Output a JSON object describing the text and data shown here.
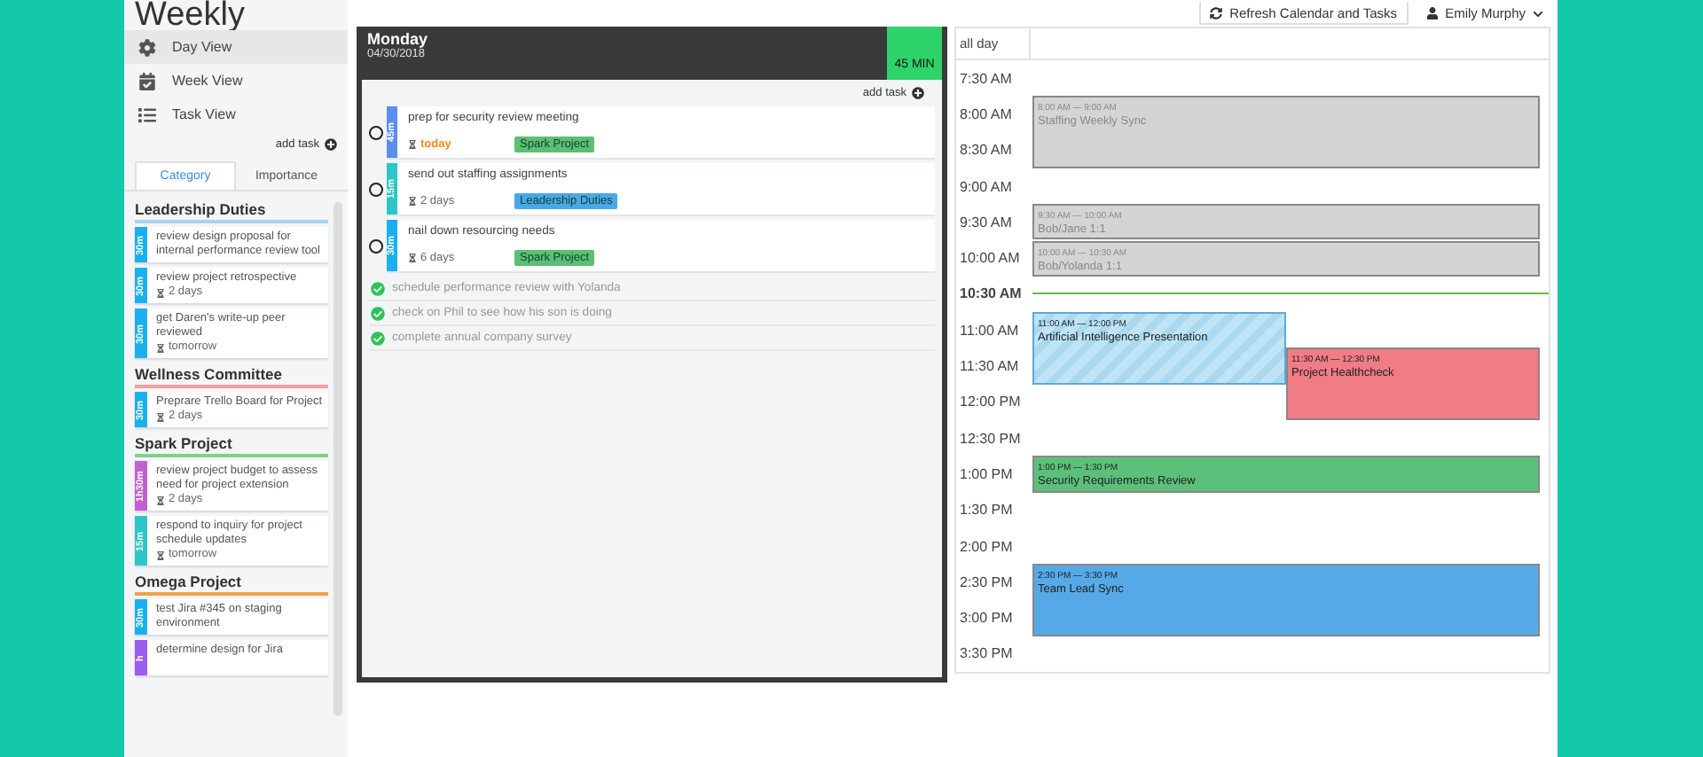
{
  "sidebar": {
    "title": "Weekly",
    "nav": [
      {
        "label": "Day View",
        "selected": true
      },
      {
        "label": "Week View",
        "selected": false
      },
      {
        "label": "Task View",
        "selected": false
      }
    ],
    "add_task": "add task",
    "tabs": [
      {
        "label": "Category",
        "selected": true
      },
      {
        "label": "Importance",
        "selected": false
      }
    ],
    "groups": [
      {
        "name": "Leadership Duties",
        "color": "#a9d3f0",
        "tasks": [
          {
            "duration": "30m",
            "color": "#1ab0f0",
            "title": "review design proposal for internal performance review tool"
          },
          {
            "duration": "30m",
            "color": "#1ab0f0",
            "title": "review project retrospective",
            "due": "2 days"
          },
          {
            "duration": "30m",
            "color": "#1ab0f0",
            "title": "get Daren's write-up peer reviewed",
            "due": "tomorrow"
          }
        ]
      },
      {
        "name": "Wellness Committee",
        "color": "#f2a0a0",
        "tasks": [
          {
            "duration": "30m",
            "color": "#1ab0f0",
            "title": "Preprare Trello Board for Project",
            "due": "2 days"
          }
        ]
      },
      {
        "name": "Spark Project",
        "color": "#7fd08a",
        "tasks": [
          {
            "duration": "1h30m",
            "color": "#c45fd4",
            "title": "review project budget to assess need for project extension",
            "due": "2 days"
          },
          {
            "duration": "15m",
            "color": "#2cc6c6",
            "title": "respond to inquiry for project schedule updates",
            "due": "tomorrow"
          }
        ]
      },
      {
        "name": "Omega Project",
        "color": "#f5a04a",
        "tasks": [
          {
            "duration": "30m",
            "color": "#1ab0f0",
            "title": "test Jira #345 on staging environment"
          },
          {
            "duration": "h",
            "color": "#9b5cf0",
            "title": "determine design for Jira"
          }
        ]
      }
    ]
  },
  "toolbar": {
    "refresh": "Refresh Calendar and Tasks",
    "user": "Emily Murphy"
  },
  "day": {
    "name": "Monday",
    "date": "04/30/2018",
    "total": "45 MIN",
    "add_task": "add task",
    "tasks": [
      {
        "done": false,
        "duration": "45m",
        "color": "#5b8def",
        "title": "prep for security review meeting",
        "due": "today",
        "due_today": true,
        "tag": {
          "label": "Spark Project",
          "color": "#5cbf73"
        }
      },
      {
        "done": false,
        "duration": "15m",
        "color": "#2cc6c6",
        "title": "send out staffing assignments",
        "due": "2 days",
        "due_today": false,
        "tag": {
          "label": "Leadership Duties",
          "color": "#4aa8e8"
        }
      },
      {
        "done": false,
        "duration": "30m",
        "color": "#1ab0f0",
        "title": "nail down resourcing needs",
        "due": "6 days",
        "due_today": false,
        "tag": {
          "label": "Spark Project",
          "color": "#5cbf73"
        }
      },
      {
        "done": true,
        "title": "schedule performance review with Yolanda"
      },
      {
        "done": true,
        "title": "check on Phil to see how his son is doing"
      },
      {
        "done": true,
        "title": "complete annual company survey"
      }
    ]
  },
  "calendar": {
    "all_day": "all day",
    "slots": [
      {
        "label": "7:30 AM",
        "current": false
      },
      {
        "label": "8:00 AM",
        "current": false
      },
      {
        "label": "8:30 AM",
        "current": false
      },
      {
        "label": "9:00 AM",
        "current": false
      },
      {
        "label": "9:30 AM",
        "current": false
      },
      {
        "label": "10:00 AM",
        "current": false
      },
      {
        "label": "10:30 AM",
        "current": true
      },
      {
        "label": "11:00 AM",
        "current": false
      },
      {
        "label": "11:30 AM",
        "current": false
      },
      {
        "label": "12:00 PM",
        "current": false
      },
      {
        "label": "12:30 PM",
        "current": false
      },
      {
        "label": "1:00 PM",
        "current": false
      },
      {
        "label": "1:30 PM",
        "current": false
      },
      {
        "label": "2:00 PM",
        "current": false
      },
      {
        "label": "2:30 PM",
        "current": false
      },
      {
        "label": "3:00 PM",
        "current": false
      },
      {
        "label": "3:30 PM",
        "current": false
      }
    ],
    "events": [
      {
        "time": "8:00 AM — 9:00 AM",
        "title": "Staffing Weekly Sync",
        "kind": "muted",
        "color": "#d4d4d4"
      },
      {
        "time": "9:30 AM — 10:00 AM",
        "title": "Bob/Jane 1:1",
        "kind": "muted",
        "color": "#d4d4d4"
      },
      {
        "time": "10:00 AM — 10:30 AM",
        "title": "Bob/Yolanda 1:1",
        "kind": "muted",
        "color": "#d4d4d4"
      },
      {
        "time": "11:00 AM — 12:00 PM",
        "title": "Artificial Intelligence Presentation",
        "kind": "striped",
        "color": "#bfe4f6"
      },
      {
        "time": "11:30 AM — 12:30 PM",
        "title": "Project Healthcheck",
        "kind": "solid",
        "color": "#f07c86"
      },
      {
        "time": "1:00 PM — 1:30 PM",
        "title": "Security Requirements Review",
        "kind": "solid",
        "color": "#5cbf7a"
      },
      {
        "time": "2:30 PM — 3:30 PM",
        "title": "Team Lead Sync",
        "kind": "solid",
        "color": "#55a9e6"
      }
    ]
  }
}
